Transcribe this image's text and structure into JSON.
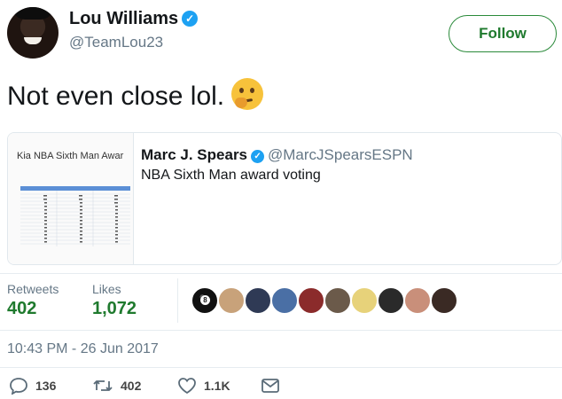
{
  "author": {
    "display_name": "Lou Williams",
    "handle": "@TeamLou23",
    "verified": true
  },
  "follow_button": {
    "label": "Follow"
  },
  "tweet": {
    "text": "Not even close lol.",
    "emoji": "thinking-face"
  },
  "quoted_tweet": {
    "image_title": "Kia NBA Sixth Man Awar",
    "author_name": "Marc J. Spears",
    "author_handle": "@MarcJSpearsESPN",
    "verified": true,
    "text": "NBA Sixth Man award voting"
  },
  "stats": {
    "retweets_label": "Retweets",
    "retweets_value": "402",
    "likes_label": "Likes",
    "likes_value": "1,072"
  },
  "likers": [
    {
      "name": "eight-ball-avatar",
      "color": "#111111"
    },
    {
      "name": "liker-avatar-2",
      "color": "#c8a27a"
    },
    {
      "name": "liker-avatar-3",
      "color": "#2f3a55"
    },
    {
      "name": "liker-avatar-4",
      "color": "#4a6fa5"
    },
    {
      "name": "liker-avatar-5",
      "color": "#8b2b2b"
    },
    {
      "name": "liker-avatar-6",
      "color": "#6b5a4a"
    },
    {
      "name": "liker-avatar-7",
      "color": "#e7d27a"
    },
    {
      "name": "liker-avatar-8",
      "color": "#2a2a2a"
    },
    {
      "name": "liker-avatar-9",
      "color": "#c98f7a"
    },
    {
      "name": "liker-avatar-10",
      "color": "#3a2a24"
    }
  ],
  "timestamp": "10:43 PM - 26 Jun 2017",
  "actions": {
    "replies": "136",
    "retweets": "402",
    "likes": "1.1K"
  },
  "colors": {
    "accent_green": "#1f7a2e",
    "verified_blue": "#1da1f2",
    "muted_text": "#657786"
  }
}
